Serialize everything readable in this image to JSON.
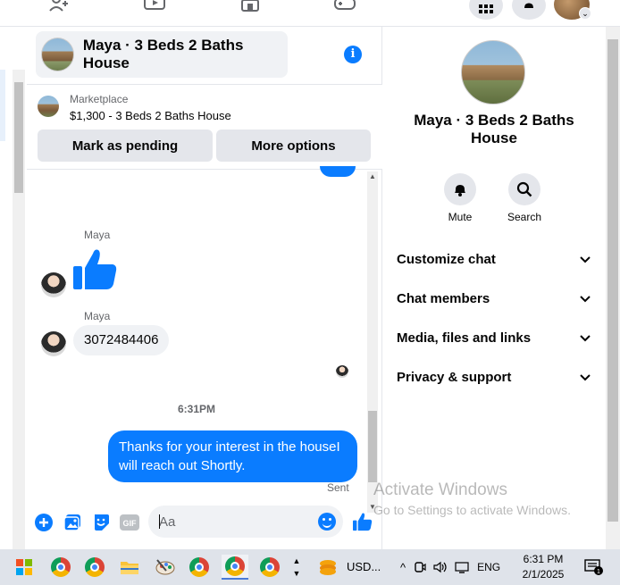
{
  "chat": {
    "title": "Maya · 3 Beds 2 Baths House",
    "marketplace_label": "Marketplace",
    "listing": "$1,300 - 3 Beds 2 Baths House",
    "mark_pending": "Mark as pending",
    "more_options": "More options"
  },
  "messages": [
    {
      "sender": "Maya",
      "type": "like"
    },
    {
      "sender": "Maya",
      "type": "text",
      "text": "3072484406"
    },
    {
      "type": "timestamp",
      "text": "6:31PM"
    },
    {
      "sender": "me",
      "type": "text",
      "text": "Thanks for your interest in the houseI will reach out Shortly.",
      "status": "Sent"
    }
  ],
  "composer": {
    "placeholder": "Aa"
  },
  "info_panel": {
    "title": "Maya · 3 Beds 2 Baths House",
    "actions": [
      {
        "label": "Mute",
        "icon": "bell-icon"
      },
      {
        "label": "Search",
        "icon": "search-icon"
      }
    ],
    "sections": [
      {
        "label": "Customize chat"
      },
      {
        "label": "Chat members"
      },
      {
        "label": "Media, files and links"
      },
      {
        "label": "Privacy & support"
      }
    ]
  },
  "watermark": {
    "line1": "Activate Windows",
    "line2": "Go to Settings to activate Windows."
  },
  "taskbar": {
    "stock_label": "USD...",
    "language": "ENG",
    "time": "6:31 PM",
    "date": "2/1/2025",
    "notification_count": "1"
  },
  "colors": {
    "accent": "#0a7cff",
    "bubble_gray": "#f0f2f5",
    "button_gray": "#e4e6eb"
  }
}
